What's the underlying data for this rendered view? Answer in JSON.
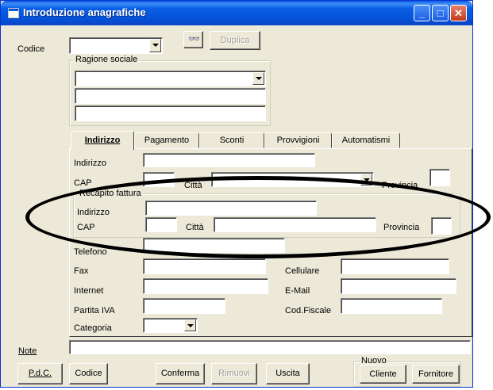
{
  "window": {
    "title": "Introduzione anagrafiche"
  },
  "header": {
    "codice_label": "Codice",
    "codice_value": "",
    "duplica_label": "Duplica",
    "search_icon": "binoculars-icon"
  },
  "ragione": {
    "label": "Ragione sociale",
    "line1": "",
    "line2": "",
    "line3": ""
  },
  "tabs": [
    "Indirizzo",
    "Pagamento",
    "Sconti",
    "Provvigioni",
    "Automatismi"
  ],
  "indirizzo": {
    "indirizzo_label": "Indirizzo",
    "cap_label": "CAP",
    "citta_label": "Città",
    "provincia_label": "Provincia"
  },
  "recapito": {
    "label": "Recapito fattura",
    "indirizzo_label": "Indirizzo",
    "cap_label": "CAP",
    "citta_label": "Città",
    "provincia_label": "Provincia"
  },
  "contacts": {
    "telefono": "Telefono",
    "fax": "Fax",
    "cellulare": "Cellulare",
    "internet": "Internet",
    "email": "E-Mail",
    "partita_iva": "Partita IVA",
    "cod_fiscale": "Cod.Fiscale",
    "categoria": "Categoria"
  },
  "note": {
    "label": "Note",
    "value": ""
  },
  "buttons": {
    "pdc": "P.d.C.",
    "codice": "Codice",
    "conferma": "Conferma",
    "rimuovi": "Rimuovi",
    "uscita": "Uscita",
    "nuovo_label": "Nuovo",
    "cliente": "Cliente",
    "fornitore": "Fornitore"
  },
  "colors": {
    "titlebar": "#0a5ae0",
    "face": "#ece9d8",
    "close": "#c6371a"
  }
}
